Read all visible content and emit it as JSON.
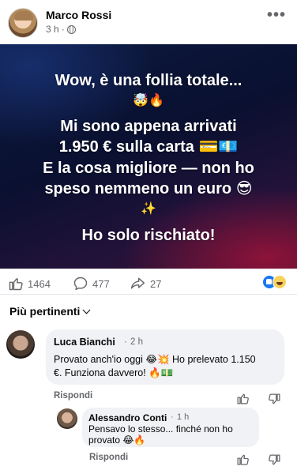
{
  "post": {
    "author": "Marco Rossi",
    "time": "3 h",
    "separator": "·",
    "more": "•••",
    "banner": {
      "line1": "Wow, è una follia totale...",
      "line1_emoji": "🤯🔥",
      "line2": "Mi sono appena arrivati",
      "line3": "1.950 € sulla carta 💳💶",
      "line4": "E la cosa migliore — non ho",
      "line5": "speso nemmeno un euro 😎",
      "line5_emoji": "✨",
      "line6": "Ho solo rischiato!"
    }
  },
  "stats": {
    "likes": "1464",
    "comments": "477",
    "shares": "27"
  },
  "filter": {
    "label": "Più pertinenti"
  },
  "comments": [
    {
      "name": "Luca Bianchi",
      "separator": "·",
      "time": "2 h",
      "line1": "Provato anch'io oggi 😂💥 Ho prelevato 1.150",
      "line2": "€. Funziona davvero! 🔥💵",
      "reply": "Rispondi"
    },
    {
      "name": "Alessandro Conti",
      "separator": "·",
      "time": "1 h",
      "line1": "Pensavo lo stesso... finché non ho",
      "line2": "provato 😂🔥",
      "reply": "Rispondi"
    }
  ],
  "colors": {
    "accent": "#1877f2",
    "muted": "#65676b",
    "bubble": "#f0f2f5"
  }
}
